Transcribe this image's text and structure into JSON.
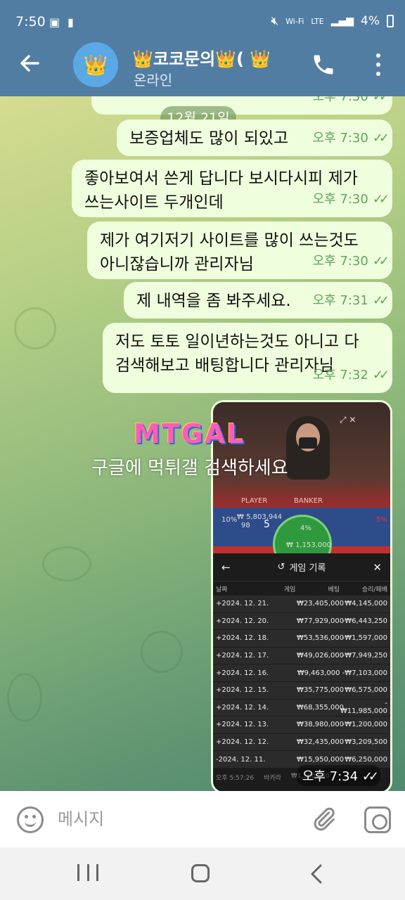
{
  "status_bar": {
    "time": "7:50",
    "network": "LTE",
    "battery": "4%",
    "icons": [
      "gallery-icon",
      "alert-icon",
      "mute-icon",
      "wifi-calling-icon",
      "signal-icon"
    ]
  },
  "header": {
    "title": "👑코코문의👑( 👑",
    "subtitle": "온라인",
    "avatar_emoji": "👑"
  },
  "chat": {
    "date_label": "12월 21일",
    "messages": [
      {
        "text": "",
        "time": "오후 7:30"
      },
      {
        "text": "보증업체도 많이 되있고",
        "time": "오후 7:30"
      },
      {
        "text": "좋아보여서 쓴게 답니다 보시다시피 제가\n쓰는사이트 두개인데",
        "time": "오후 7:30"
      },
      {
        "text": "제가 여기저기 사이트를 많이 쓰는것도\n아니잖습니까 관리자님",
        "time": "오후 7:30"
      },
      {
        "text": "제 내역을 좀 봐주세요.",
        "time": "오후 7:31"
      },
      {
        "text": "저도 토토 일이년하는것도 아니고 다\n검색해보고 배팅합니다 관리자님",
        "time": "오후 7:32"
      }
    ],
    "media_time": "오후 7:34"
  },
  "screenshot": {
    "live": {
      "player_label": "PLAYER",
      "banker_label": "BANKER",
      "pool_amount": "₩ 5,803,944",
      "player_count": "98",
      "center_value": "5",
      "green_value": "4%",
      "green_amount": "₩ 1,153,000",
      "pct_left": "10%",
      "pct_right": "5%"
    },
    "history_title": "게임 기록",
    "columns": [
      "날짜",
      "게임",
      "베팅",
      "승리/패배"
    ],
    "rows": [
      {
        "date": "+2024. 12. 21.",
        "bet": "₩23,405,000",
        "result": "₩4,145,000"
      },
      {
        "date": "+2024. 12. 20.",
        "bet": "₩77,929,000",
        "result": "-₩6,443,250"
      },
      {
        "date": "+2024. 12. 18.",
        "bet": "₩53,536,000",
        "result": "-₩1,597,000"
      },
      {
        "date": "+2024. 12. 17.",
        "bet": "₩49,026,000",
        "result": "-₩7,949,250"
      },
      {
        "date": "+2024. 12. 16.",
        "bet": "₩9,463,000",
        "result": "-₩7,103,000"
      },
      {
        "date": "+2024. 12. 15.",
        "bet": "₩35,775,000",
        "result": "₩6,575,000"
      },
      {
        "date": "+2024. 12. 14.",
        "bet": "₩68,355,000",
        "result": "-₩11,985,000"
      },
      {
        "date": "+2024. 12. 13.",
        "bet": "₩38,980,000",
        "result": "-₩1,200,000"
      },
      {
        "date": "+2024. 12. 12.",
        "bet": "₩32,435,000",
        "result": "₩3,209,500"
      },
      {
        "date": "-2024. 12. 11.",
        "bet": "₩15,950,000",
        "result": "₩6,250,000"
      }
    ],
    "last_row": {
      "time": "오후 5:57:26",
      "game": "바카라",
      "bet": "₩1,500,000"
    }
  },
  "watermark": {
    "logo": "MTGAL",
    "text": "구글에 먹튀갤 검색하세요"
  },
  "input_bar": {
    "placeholder": "메시지"
  },
  "colors": {
    "header_bg": "#527da3",
    "bubble_bg": "#effedd",
    "time_green": "#5fa55a"
  }
}
